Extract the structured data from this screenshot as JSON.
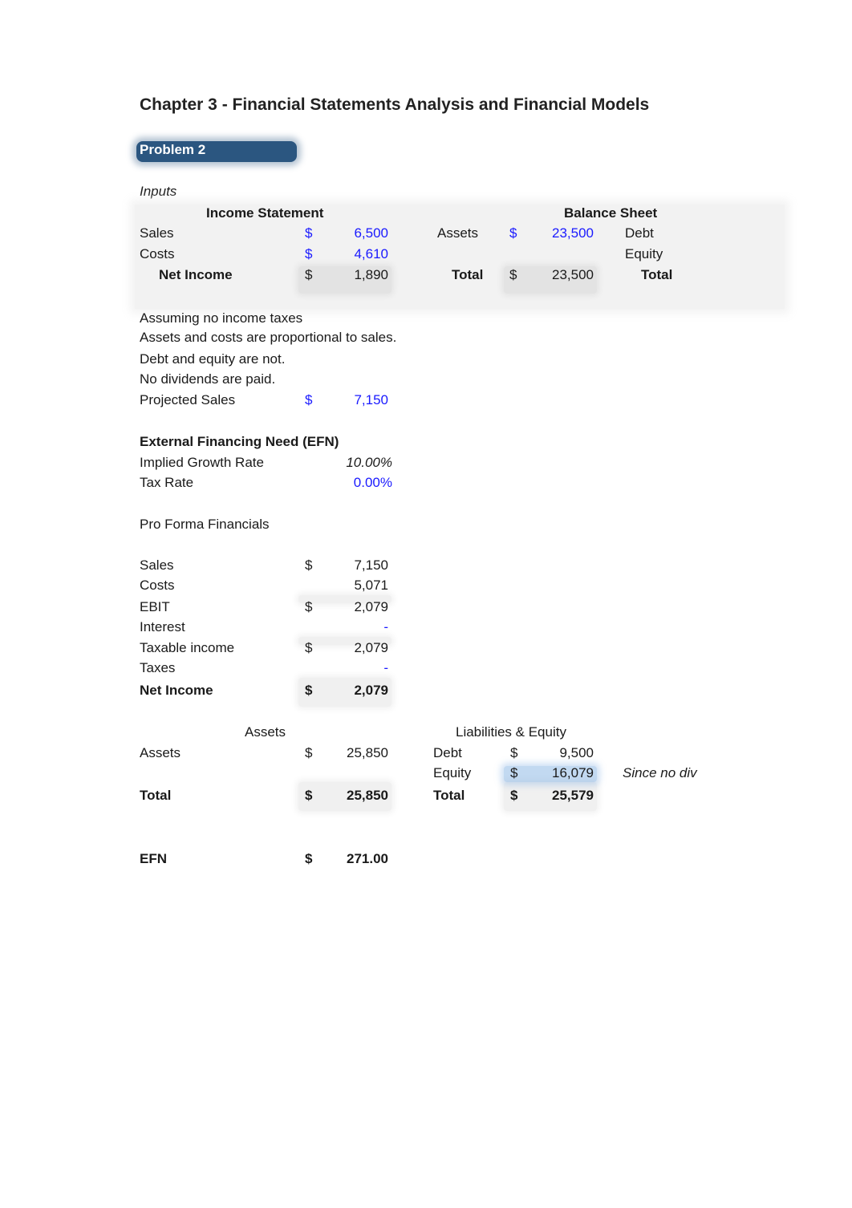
{
  "title": "Chapter 3 - Financial Statements Analysis and Financial Models",
  "problem_label": "Problem 2",
  "inputs": {
    "label": "Inputs",
    "income_statement": {
      "header": "Income Statement",
      "rows": [
        {
          "label": "Sales",
          "currency": "$",
          "value": "6,500"
        },
        {
          "label": "Costs",
          "currency": "$",
          "value": "4,610"
        },
        {
          "label": "Net Income",
          "currency": "$",
          "value": "1,890"
        }
      ]
    },
    "balance_sheet": {
      "header": "Balance Sheet",
      "assets_label": "Assets",
      "assets_currency": "$",
      "assets_value": "23,500",
      "total_label": "Total",
      "total_currency": "$",
      "total_value": "23,500",
      "debt_label": "Debt",
      "equity_label": "Equity",
      "liab_total_label": "Total"
    }
  },
  "assumptions": [
    "Assuming no income taxes",
    "Assets and costs are proportional to sales.",
    "Debt and equity are not.",
    "No dividends are paid."
  ],
  "projected_sales": {
    "label": "Projected Sales",
    "currency": "$",
    "value": "7,150"
  },
  "efn_section": {
    "header": "External Financing Need (EFN)",
    "growth_label": "Implied Growth Rate",
    "growth_value": "10.00%",
    "tax_label": "Tax Rate",
    "tax_value": "0.00%"
  },
  "pro_forma": {
    "header": "Pro Forma Financials",
    "rows": [
      {
        "label": "Sales",
        "currency": "$",
        "value": "7,150"
      },
      {
        "label": "Costs",
        "currency": "",
        "value": "5,071"
      },
      {
        "label": "EBIT",
        "currency": "$",
        "value": "2,079"
      },
      {
        "label": "Interest",
        "currency": "",
        "value": "-"
      },
      {
        "label": "Taxable income",
        "currency": "$",
        "value": "2,079"
      },
      {
        "label": "Taxes",
        "currency": "",
        "value": "-"
      },
      {
        "label": "Net Income",
        "currency": "$",
        "value": "2,079"
      }
    ]
  },
  "pro_forma_bs": {
    "assets_header": "Assets",
    "liab_header": "Liabilities & Equity",
    "assets_label": "Assets",
    "assets_currency": "$",
    "assets_value": "25,850",
    "assets_total_label": "Total",
    "assets_total_currency": "$",
    "assets_total_value": "25,850",
    "debt_label": "Debt",
    "debt_currency": "$",
    "debt_value": "9,500",
    "equity_label": "Equity",
    "equity_currency": "$",
    "equity_value": "16,079",
    "equity_note": "Since no div",
    "liab_total_label": "Total",
    "liab_total_currency": "$",
    "liab_total_value": "25,579"
  },
  "efn": {
    "label": "EFN",
    "currency": "$",
    "value": "271.00"
  }
}
